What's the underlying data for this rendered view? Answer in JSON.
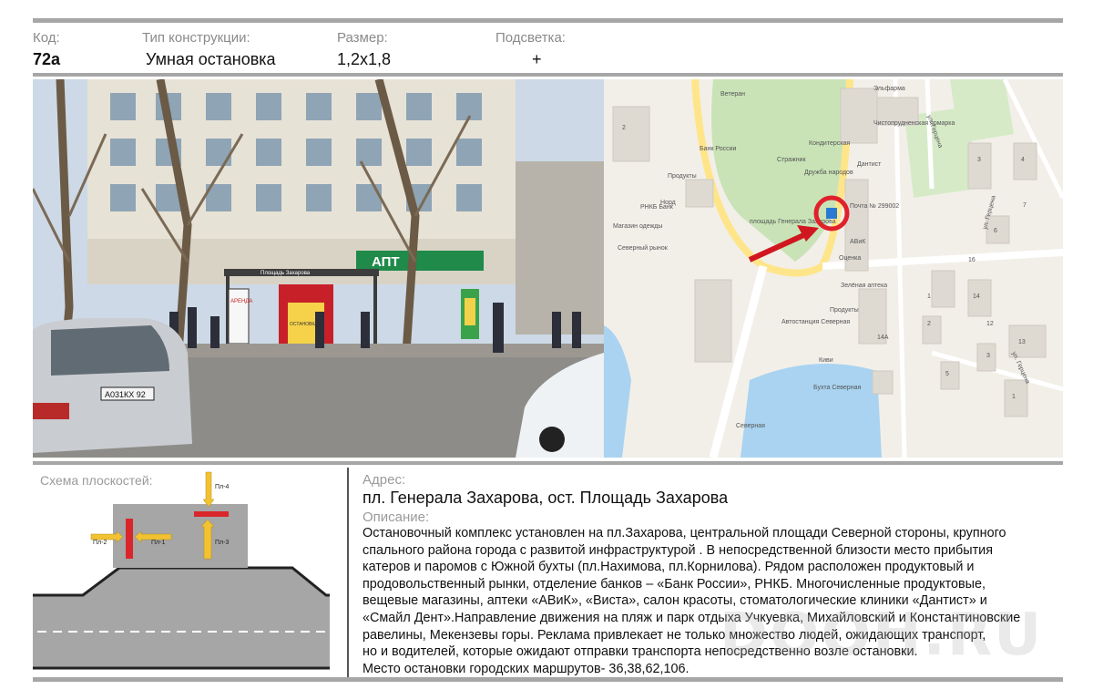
{
  "header": {
    "code_label": "Код:",
    "code_value": "72а",
    "type_label": "Тип конструкции:",
    "type_value": "Умная остановка",
    "size_label": "Размер:",
    "size_value": "1,2x1,8",
    "light_label": "Подсветка:",
    "light_value": "+"
  },
  "photo": {
    "plate": "А031КХ 92",
    "stop_sign": "Площадь Захарова",
    "shop_sign": "АПТ",
    "ad_text": "АРЕНДА",
    "stop_text": "ОСТАНОВКА"
  },
  "map": {
    "street_1": "ул. Герцена",
    "street_2": "ул. Герцена",
    "street_3": "ул. Герцена",
    "square": "площадь Генерала Захарова",
    "poi": [
      "Эльфарма",
      "Ветеран",
      "Кондитерская",
      "Банк России",
      "Продукты",
      "Дантист",
      "Стражник",
      "Дружба народов",
      "РНКБ Банк",
      "Норд",
      "Магазин одежды",
      "Северный рынок",
      "Почта № 299002",
      "АВиК",
      "Оценка",
      "Зелёная аптека",
      "Продукты",
      "Автостанция Северная",
      "Киви",
      "Бухта Северная",
      "Северная",
      "Чистопрудненская ярмарка"
    ],
    "buildings": [
      "2",
      "3",
      "4",
      "6",
      "7",
      "16",
      "14",
      "13",
      "12",
      "14А",
      "1",
      "2",
      "5",
      "3",
      "1"
    ],
    "colors": {
      "marker": "#e0212b",
      "arrow": "#d01720",
      "water": "#a9d3f0",
      "park": "#c9e3b7",
      "road": "#ffe58a"
    }
  },
  "schema": {
    "title": "Схема плоскостей:",
    "planes": [
      "Пл-1",
      "Пл-2",
      "Пл-3",
      "Пл-4"
    ],
    "colors": {
      "plane": "#d9262b",
      "arrow": "#f2c232",
      "road": "#a6a6a6",
      "kerb": "#222222"
    }
  },
  "info": {
    "address_label": "Адрес:",
    "address": "пл. Генерала Захарова, ост. Площадь Захарова",
    "description_label": "Описание:",
    "description": "Остановочный комплекс установлен на пл.Захарова, центральной площади Северной стороны,  крупного\nспального района города  с развитой инфраструктурой  . В непосредственной близости место прибытия\nкатеров и паромов с Южной бухты (пл.Нахимова, пл.Корнилова). Рядом  расположен  продуктовый и\nпродовольственный рынки, отделение банков – «Банк России», РНКБ. Многочисленные продуктовые,\nвещевые магазины, аптеки «АВиК», «Виста»,   салон красоты, стоматологические клиники  «Дантист» и\n«Смайл Дент».Направление движения на пляж и парк отдыха Учкуевка, Михайловский и Константиновские\nравелины, Мекензевы горы. Реклама привлекает не только множество людей, ожидающих транспорт,\nно и водителей, которые ожидают отправки транспорта непосредственно возле остановки.\nМесто остановки городских маршрутов- 36,38,62,106."
  },
  "watermark": "DOOH.RU"
}
